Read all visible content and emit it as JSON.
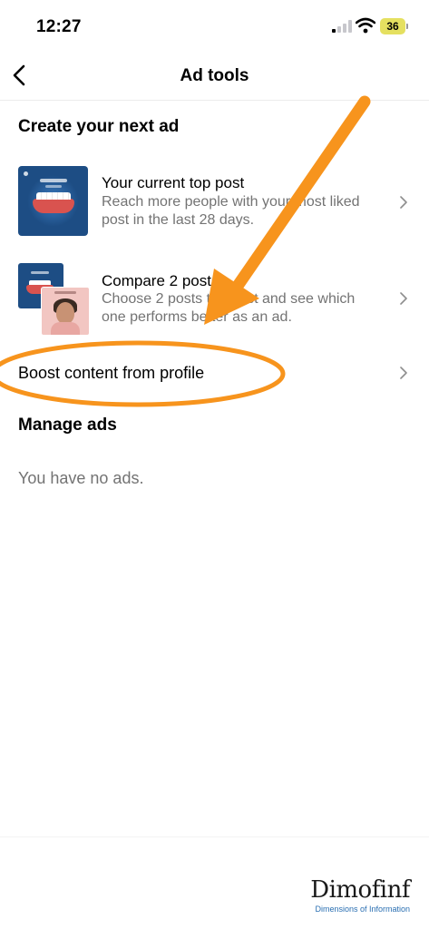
{
  "status_bar": {
    "time": "12:27",
    "battery": "36",
    "battery_color": "#e5e060"
  },
  "nav": {
    "title": "Ad tools",
    "back_icon": "chevron-left-icon"
  },
  "create_section": {
    "title": "Create your next ad",
    "items": [
      {
        "title": "Your current top post",
        "subtitle": "Reach more people with your most liked post in the last 28 days.",
        "icon": "chevron-right-icon"
      },
      {
        "title": "Compare 2 posts",
        "subtitle": "Choose 2 posts to boost and see which one performs better as an ad.",
        "icon": "chevron-right-icon"
      }
    ],
    "boost_row": {
      "label": "Boost content from profile",
      "icon": "chevron-right-icon"
    }
  },
  "manage_section": {
    "title": "Manage ads",
    "empty_text": "You have no ads."
  },
  "annotation": {
    "arrow_color": "#f7941d",
    "ellipse_color": "#f7941d"
  },
  "watermark": {
    "logo": "Dimofinf",
    "tagline": "Dimensions of Information",
    "tagline_color": "#2a6fb2"
  }
}
